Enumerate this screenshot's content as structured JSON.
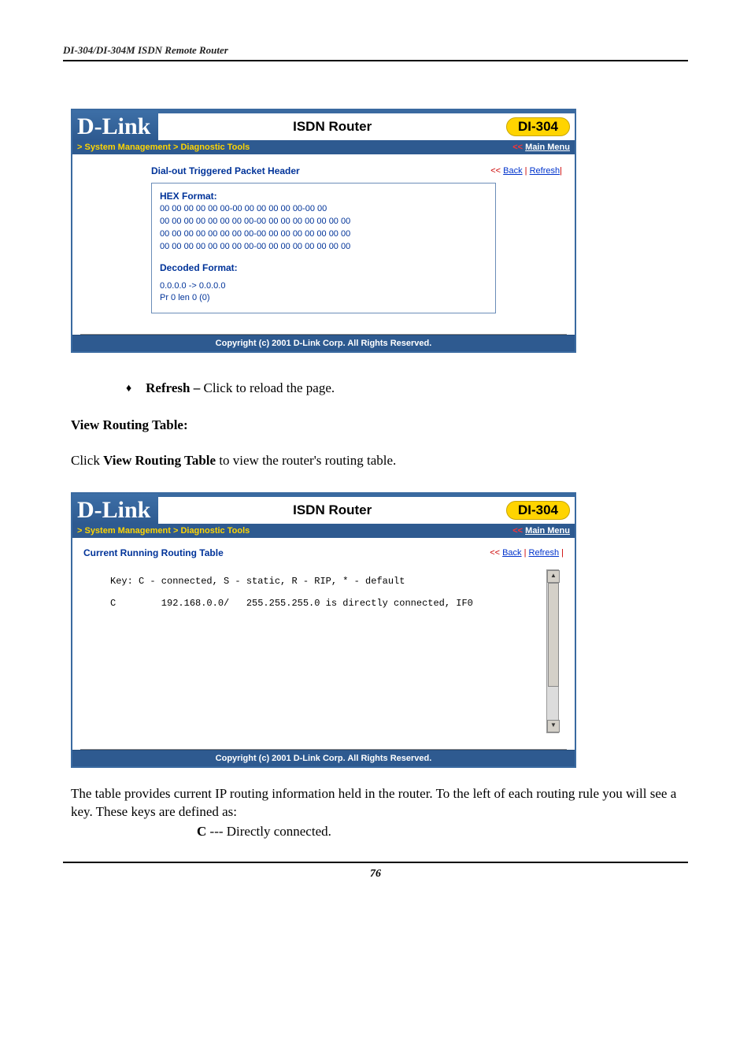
{
  "header": {
    "running": "DI-304/DI-304M ISDN Remote Router"
  },
  "panelA": {
    "logo": "D-Link",
    "title": "ISDN Router",
    "model": "DI-304",
    "crumb": "> System Management > Diagnostic Tools",
    "mainmenu_prefix": "<< ",
    "mainmenu_link": "Main Menu",
    "section_title": "Dial-out Triggered Packet Header",
    "back_prefix": "<< ",
    "back": "Back",
    "sep": " | ",
    "refresh": "Refresh",
    "hex_label": "HEX Format:",
    "hex_lines": [
      "00 00 00 00 00 00-00 00 00 00 00 00-00 00",
      "",
      "00 00 00 00 00 00 00 00-00 00 00 00 00 00 00 00",
      "00 00 00 00 00 00 00 00-00 00 00 00 00 00 00 00",
      "00 00 00 00 00 00 00 00-00 00 00 00 00 00 00 00"
    ],
    "decoded_label": "Decoded Format:",
    "decoded_lines": [
      "0.0.0.0 -> 0.0.0.0",
      "Pr 0 len 0 (0)"
    ],
    "footer": "Copyright (c) 2001 D-Link Corp. All Rights Reserved."
  },
  "bodyA": {
    "bullet_bold": "Refresh – ",
    "bullet_text": "Click to reload the page.",
    "heading": "View Routing Table:",
    "para_pre": "Click ",
    "para_bold": "View Routing Table",
    "para_post": " to view the router's routing table."
  },
  "panelB": {
    "logo": "D-Link",
    "title": "ISDN Router",
    "model": "DI-304",
    "crumb": "> System Management > Diagnostic Tools",
    "mainmenu_prefix": "<< ",
    "mainmenu_link": "Main Menu",
    "section_title": "Current Running Routing Table",
    "back_prefix": "<< ",
    "back": "Back",
    "sep": " | ",
    "refresh": "Refresh",
    "routing_text": "Key: C - connected, S - static, R - RIP, * - default\n\nC        192.168.0.0/   255.255.255.0 is directly connected, IF0",
    "footer": "Copyright (c) 2001 D-Link Corp. All Rights Reserved."
  },
  "bodyB": {
    "para": "The table provides current IP routing information held in the router. To the left of each routing rule you will see a key. These keys are defined as:",
    "key_bold": "C",
    "key_rest": " --- Directly connected."
  },
  "page_number": "76"
}
